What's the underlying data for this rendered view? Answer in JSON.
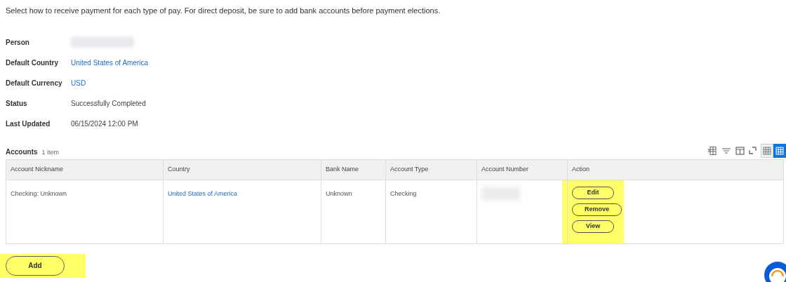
{
  "instructions": "Select how to receive payment for each type of pay. For direct deposit, be sure to add bank accounts before payment elections.",
  "fields": [
    {
      "label": "Person",
      "kind": "redacted"
    },
    {
      "label": "Default Country",
      "kind": "link",
      "value": "United States of America"
    },
    {
      "label": "Default Currency",
      "kind": "link",
      "value": "USD"
    },
    {
      "label": "Status",
      "kind": "text",
      "value": "Successfully Completed"
    },
    {
      "label": "Last Updated",
      "kind": "text",
      "value": "06/15/2024 12:00 PM"
    }
  ],
  "accounts": {
    "title": "Accounts",
    "count": "1 item",
    "view_toggles": [
      {
        "selected": false
      },
      {
        "selected": true
      }
    ],
    "columns": [
      "Account Nickname",
      "Country",
      "Bank Name",
      "Account Type",
      "Account Number",
      "Action"
    ],
    "rows": [
      {
        "cells": [
          {
            "kind": "text",
            "value": "Checking: Unknown"
          },
          {
            "kind": "link",
            "value": "United States of America"
          },
          {
            "kind": "text",
            "value": "Unknown"
          },
          {
            "kind": "text",
            "value": "Checking"
          },
          {
            "kind": "redacted"
          },
          {
            "kind": "actions",
            "buttons": [
              "Edit",
              "Remove",
              "View"
            ]
          }
        ]
      }
    ]
  },
  "add_button": "Add"
}
